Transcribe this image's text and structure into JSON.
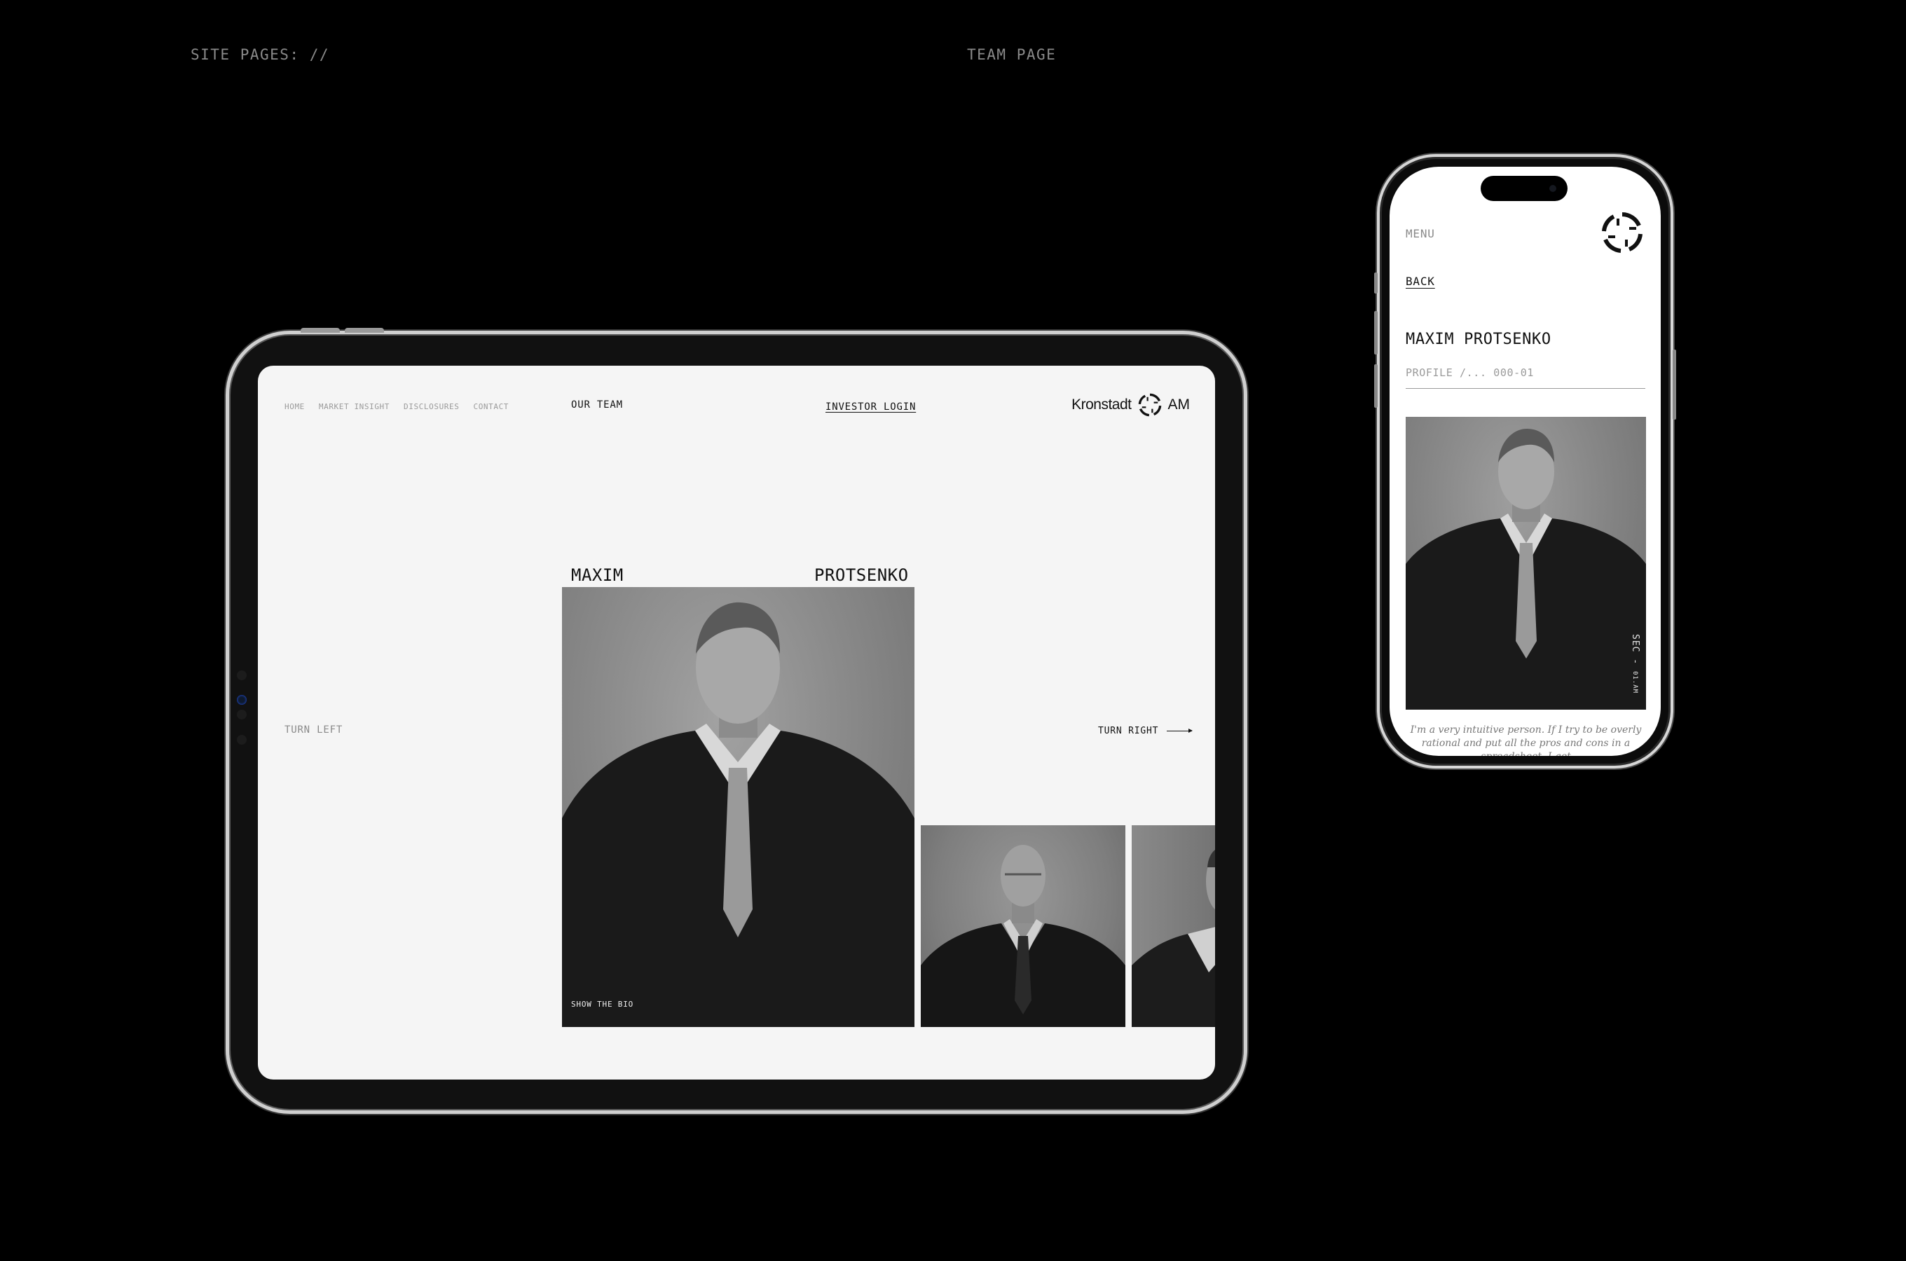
{
  "page": {
    "header_left": "SITE PAGES: //",
    "header_right": "TEAM PAGE"
  },
  "tablet": {
    "nav": [
      "HOME",
      "MARKET INSIGHT",
      "DISCLOSURES",
      "CONTACT"
    ],
    "section_title": "OUR TEAM",
    "investor_login": "INVESTOR LOGIN",
    "logo": {
      "word1": "Kronstadt",
      "word2": "AM"
    },
    "member": {
      "first_name": "MAXIM",
      "last_name": "PROTSENKO",
      "show_bio": "SHOW THE BIO"
    },
    "turn_left": "TURN LEFT",
    "turn_right": "TURN RIGHT"
  },
  "phone": {
    "menu": "MENU",
    "back": "BACK",
    "name": "MAXIM PROTSENKO",
    "profile": "PROFILE /... 000-01",
    "vertical_label": "SEC - ",
    "vertical_small": "01.AM",
    "quote": "I'm a very intuitive person. If I try to be overly rational and put all the pros and cons in a spreadsheet, I get"
  },
  "colors": {
    "background": "#000000",
    "screen": "#f5f5f5",
    "text_dark": "#111111",
    "text_muted": "#8a8a8a"
  }
}
